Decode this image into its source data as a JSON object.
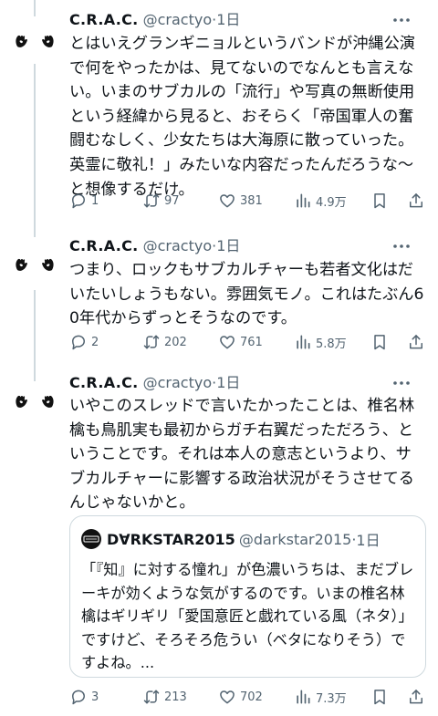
{
  "tweets": [
    {
      "name": "C.R.A.C.",
      "handle": "@cractyo",
      "time": "1日",
      "text": "とはいえグランギニョルというバンドが沖縄公演で何をやったかは、見てないのでなんとも言えない。いまのサブカルの「流行」や写真の無断使用という経緯から見ると、おそらく「帝国軍人の奮闘むなしく、少女たちは大海原に散っていった。英霊に敬礼！」みたいな内容だったんだろうな〜と想像するだけ。",
      "replies": "1",
      "retweets": "97",
      "likes": "381",
      "views": "4.9万"
    },
    {
      "name": "C.R.A.C.",
      "handle": "@cractyo",
      "time": "1日",
      "text": "つまり、ロックもサブカルチャーも若者文化はだいたいしょうもない。雰囲気モノ。これはたぶん60年代からずっとそうなのです。",
      "replies": "2",
      "retweets": "202",
      "likes": "761",
      "views": "5.8万"
    },
    {
      "name": "C.R.A.C.",
      "handle": "@cractyo",
      "time": "1日",
      "text": "いやこのスレッドで言いたかったことは、椎名林檎も鳥肌実も最初からガチ右翼だっただろう、ということです。それは本人の意志というより、サブカルチャーに影響する政治状況がそうさせてるんじゃないかと。",
      "replies": "3",
      "retweets": "213",
      "likes": "702",
      "views": "7.3万",
      "quote": {
        "name": "D∀RKSTAR2015",
        "handle": "@darkstar2015",
        "time": "1日",
        "text": "「『知』に対する憧れ」が色濃いうちは、まだブレーキが効くような気がするのです。いまの椎名林檎はギリギリ「愛国意匠と戯れている風（ネタ）」ですけど、そろそろ危うい（ベタになりそう）ですよね。..."
      }
    }
  ],
  "colors": {
    "text": "#0f1419",
    "secondary": "#536471",
    "border": "#cfd9de"
  },
  "icons": [
    "avatar-hands",
    "more-icon",
    "reply-icon",
    "retweet-icon",
    "like-icon",
    "views-icon",
    "bookmark-icon",
    "share-icon"
  ]
}
